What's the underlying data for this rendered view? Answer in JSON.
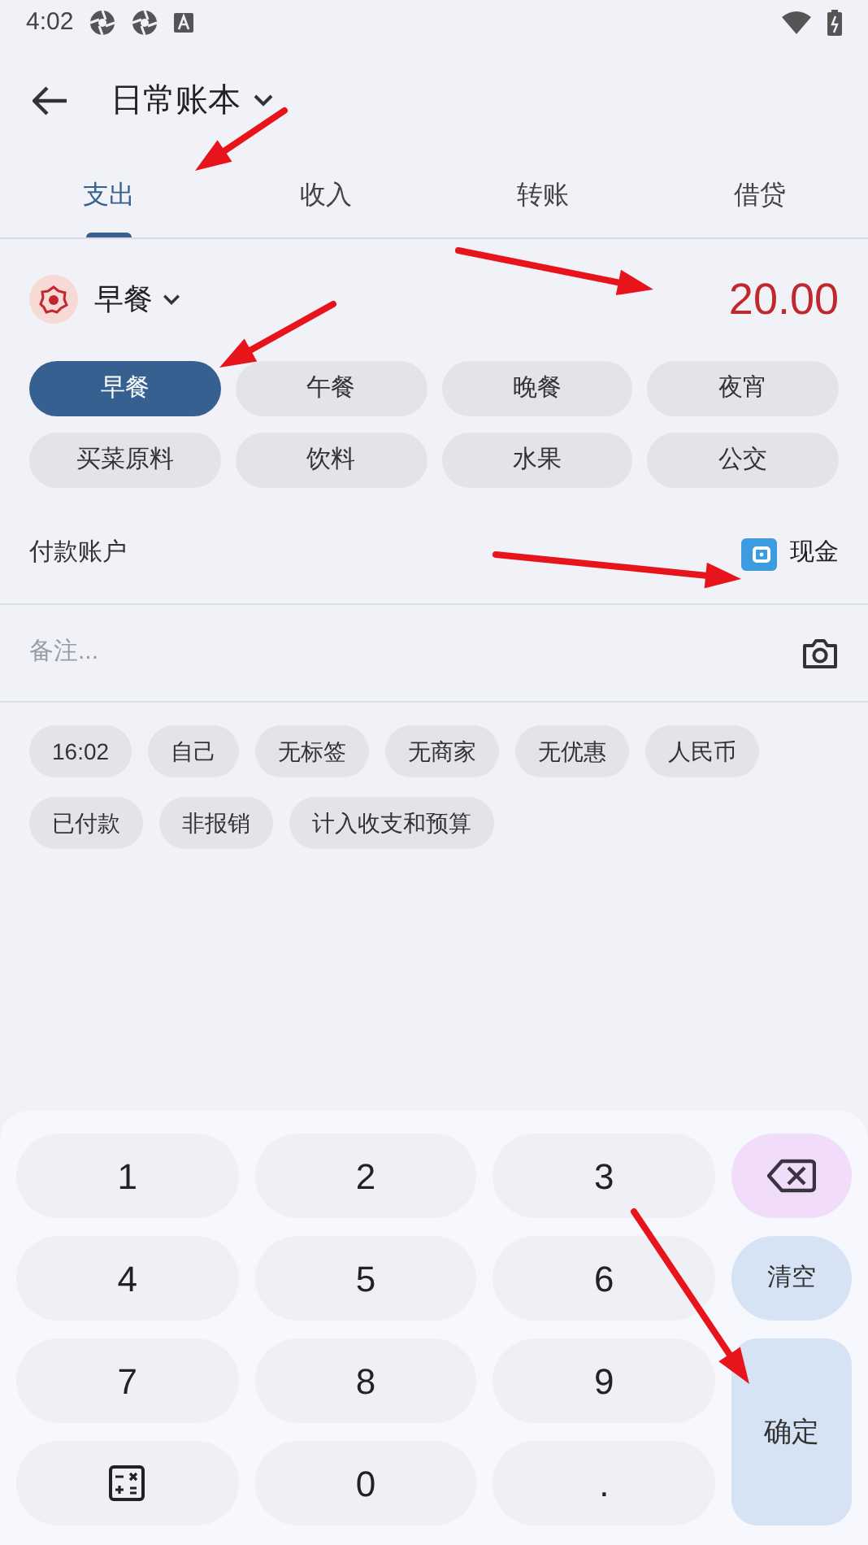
{
  "status_bar": {
    "time": "4:02"
  },
  "header": {
    "title": "日常账本"
  },
  "tabs": [
    {
      "label": "支出",
      "selected": true
    },
    {
      "label": "收入",
      "selected": false
    },
    {
      "label": "转账",
      "selected": false
    },
    {
      "label": "借贷",
      "selected": false
    }
  ],
  "category": {
    "name": "早餐",
    "amount": "20.00"
  },
  "quick_categories": [
    {
      "label": "早餐",
      "selected": true
    },
    {
      "label": "午餐",
      "selected": false
    },
    {
      "label": "晚餐",
      "selected": false
    },
    {
      "label": "夜宵",
      "selected": false
    },
    {
      "label": "买菜原料",
      "selected": false
    },
    {
      "label": "饮料",
      "selected": false
    },
    {
      "label": "水果",
      "selected": false
    },
    {
      "label": "公交",
      "selected": false
    }
  ],
  "payment": {
    "label": "付款账户",
    "account": "现金"
  },
  "note": {
    "placeholder": "备注..."
  },
  "tag_rows": [
    [
      "16:02",
      "自己",
      "无标签",
      "无商家",
      "无优惠",
      "人民币"
    ],
    [
      "已付款",
      "非报销",
      "计入收支和预算"
    ]
  ],
  "keypad": [
    {
      "kind": "digit",
      "label": "1"
    },
    {
      "kind": "digit",
      "label": "2"
    },
    {
      "kind": "digit",
      "label": "3"
    },
    {
      "kind": "backspace"
    },
    {
      "kind": "digit",
      "label": "4"
    },
    {
      "kind": "digit",
      "label": "5"
    },
    {
      "kind": "digit",
      "label": "6"
    },
    {
      "kind": "clear",
      "label": "清空"
    },
    {
      "kind": "digit",
      "label": "7"
    },
    {
      "kind": "digit",
      "label": "8"
    },
    {
      "kind": "digit",
      "label": "9"
    },
    {
      "kind": "confirm",
      "label": "确定"
    },
    {
      "kind": "calculator"
    },
    {
      "kind": "digit",
      "label": "0"
    },
    {
      "kind": "digit",
      "label": "."
    }
  ]
}
